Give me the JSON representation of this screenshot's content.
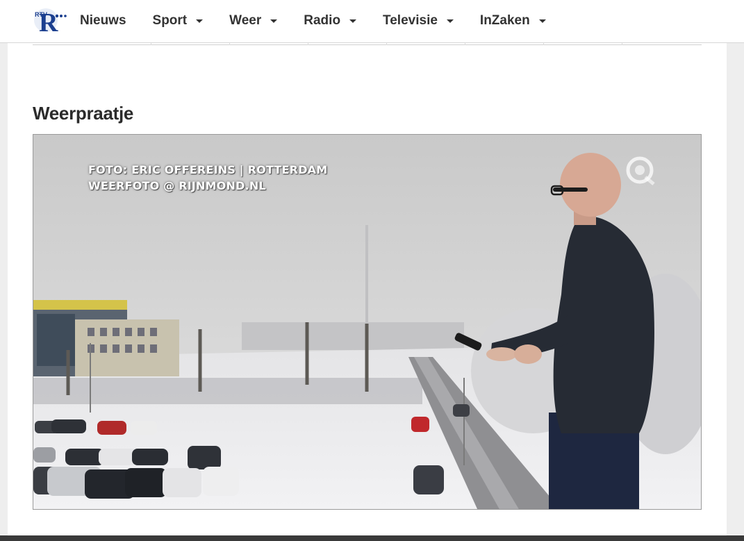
{
  "brand": {
    "logo_text": "RTV",
    "logo_letter": "R"
  },
  "nav": {
    "items": [
      {
        "label": "Nieuws",
        "has_dropdown": false
      },
      {
        "label": "Sport",
        "has_dropdown": true
      },
      {
        "label": "Weer",
        "has_dropdown": true
      },
      {
        "label": "Radio",
        "has_dropdown": true
      },
      {
        "label": "Televisie",
        "has_dropdown": true
      },
      {
        "label": "InZaken",
        "has_dropdown": true
      }
    ]
  },
  "section": {
    "title": "Weerpraatje"
  },
  "video": {
    "caption_line1": "FOTO: ERIC OFFEREINS | ROTTERDAM",
    "caption_line2": "WEERFOTO @ RIJNMOND.NL"
  },
  "colors": {
    "accent": "#1b3f8f",
    "text": "#333333"
  }
}
